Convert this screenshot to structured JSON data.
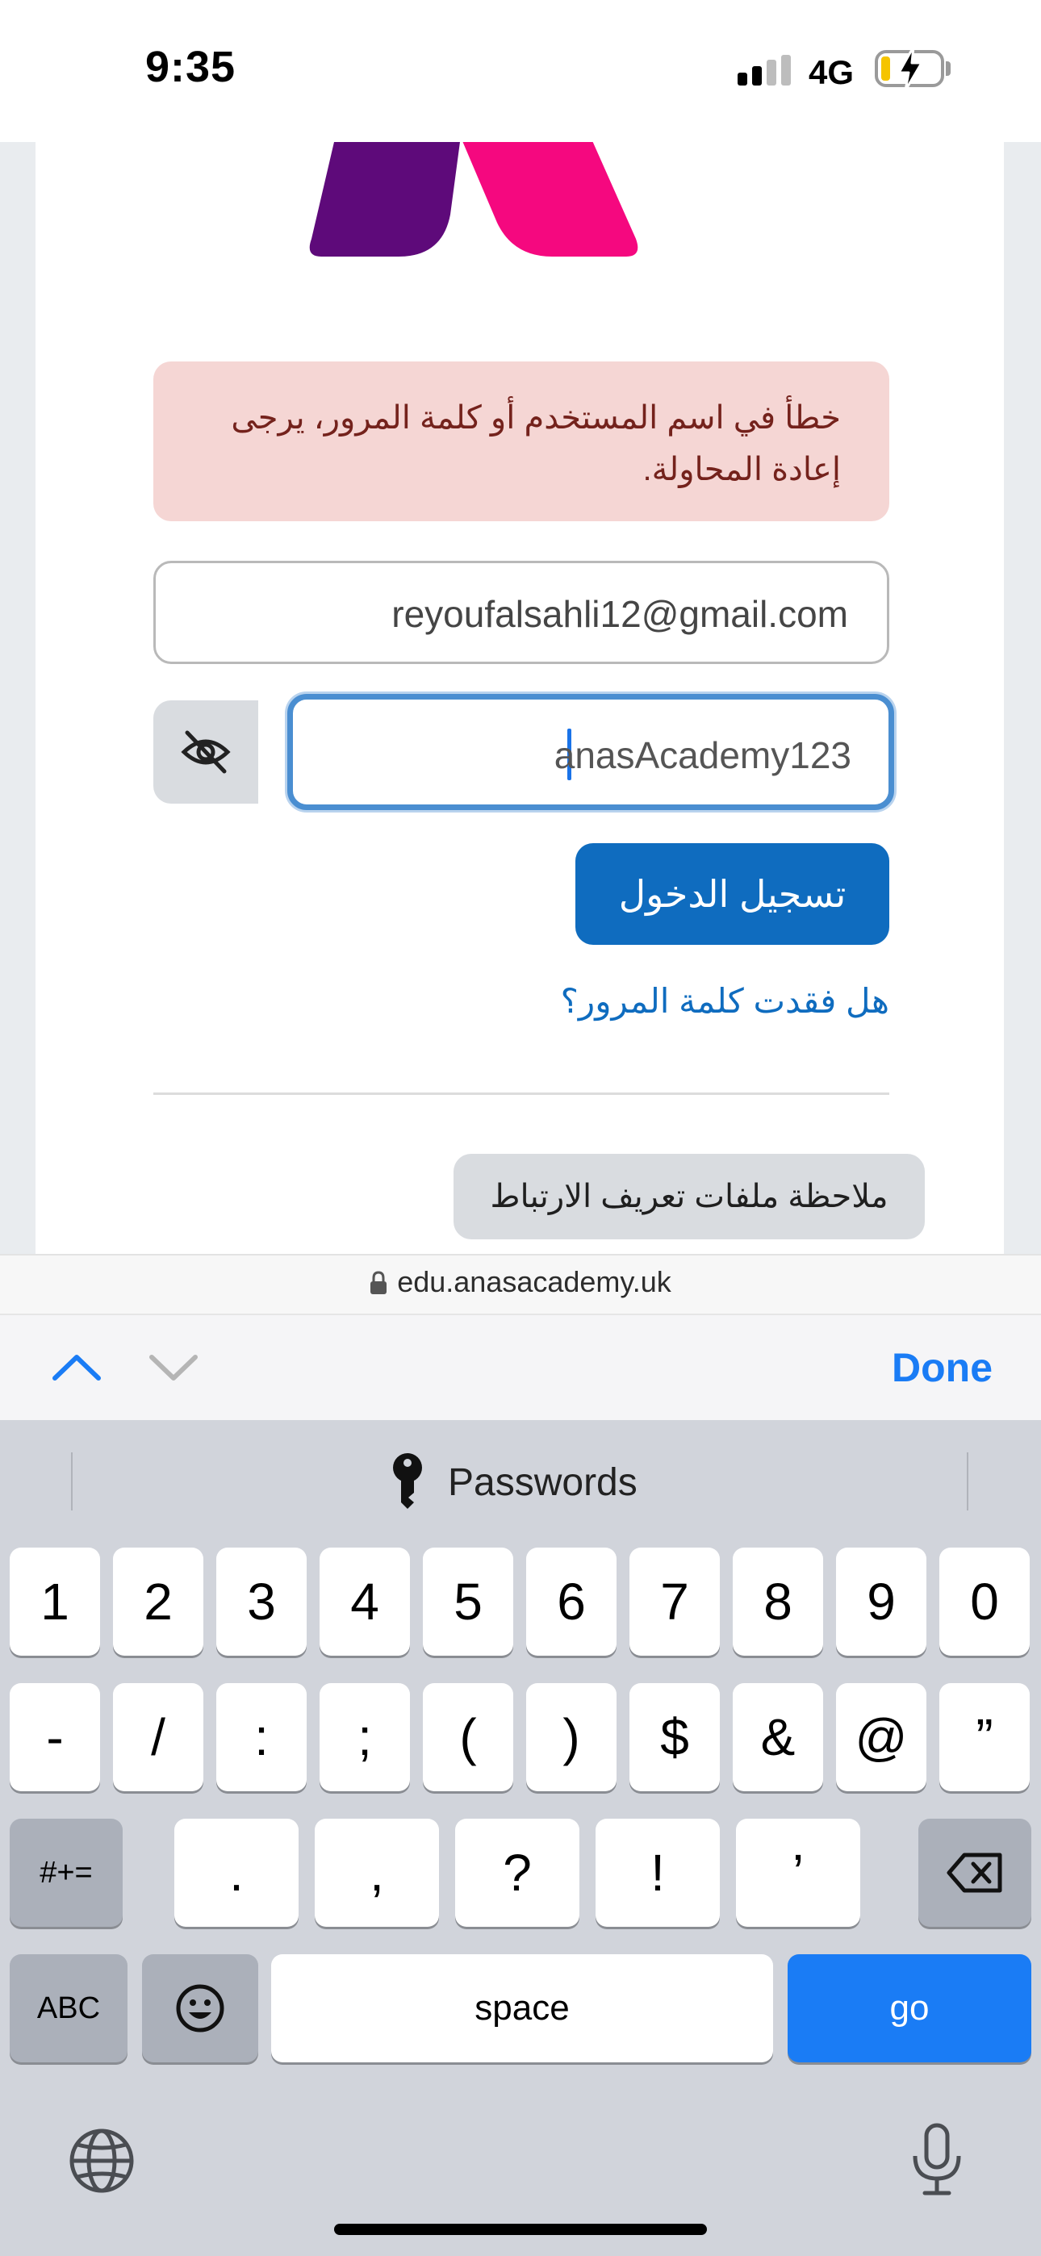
{
  "status_bar": {
    "time": "9:35",
    "network": "4G",
    "battery_level": 0.15,
    "battery_color": "#f5c400",
    "charging": true
  },
  "page": {
    "alert_text": "خطأ في اسم المستخدم أو كلمة المرور، يرجى إعادة المحاولة.",
    "username_value": "reyoufalsahli12@gmail.com",
    "password_value": "anasAcademy123",
    "password_visibility_icon": "eye-slash-icon",
    "login_button_label": "تسجيل الدخول",
    "forgot_password_link": "هل فقدت كلمة المرور؟",
    "cookie_notice_button": "ملاحظة ملفات تعريف الارتباط",
    "colors": {
      "primary": "#0f6cbf",
      "alert_bg": "#f5d6d4",
      "alert_text": "#74221c",
      "logo_purple": "#5e0a7a",
      "logo_pink": "#f5087f"
    }
  },
  "url_bar": {
    "url": "edu.anasacademy.uk"
  },
  "accessory_bar": {
    "done_label": "Done"
  },
  "keyboard": {
    "suggestion": "Passwords",
    "row1": [
      "1",
      "2",
      "3",
      "4",
      "5",
      "6",
      "7",
      "8",
      "9",
      "0"
    ],
    "row2": [
      "-",
      "/",
      ":",
      ";",
      "(",
      ")",
      "$",
      "&",
      "@",
      "”"
    ],
    "row3_shift": "#+=",
    "row3": [
      ".",
      ",",
      "?",
      "!",
      "’"
    ],
    "abc_label": "ABC",
    "space_label": "space",
    "go_label": "go"
  }
}
